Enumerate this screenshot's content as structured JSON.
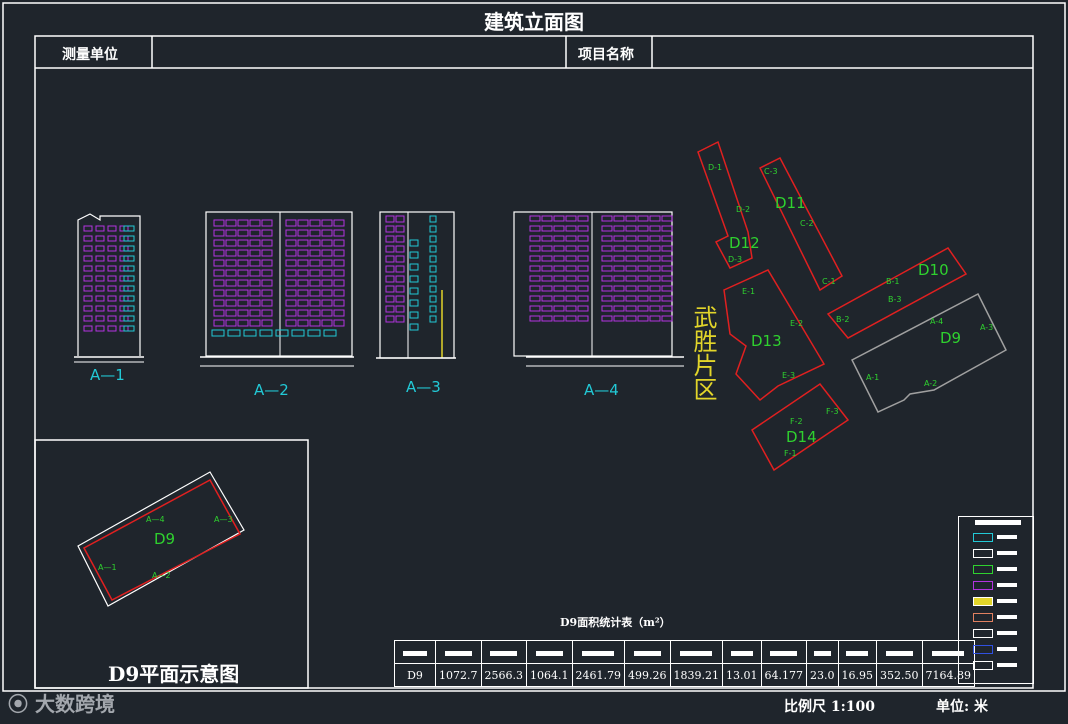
{
  "title": "建筑立面图",
  "header": {
    "survey_unit_label": "测量单位",
    "project_name_label": "项目名称"
  },
  "elevations": [
    {
      "id": "A-1",
      "label": "A—1"
    },
    {
      "id": "A-2",
      "label": "A—2"
    },
    {
      "id": "A-3",
      "label": "A—3"
    },
    {
      "id": "A-4",
      "label": "A—4"
    }
  ],
  "district_label": "武胜片区",
  "site_map": {
    "buildings": [
      "D9",
      "D10",
      "D11",
      "D12",
      "D13",
      "D14"
    ],
    "point_labels": [
      "D-1",
      "D-2",
      "D-3",
      "C-1",
      "C-2",
      "C-3",
      "B-1",
      "B-2",
      "B-3",
      "E-1",
      "E-2",
      "E-3",
      "F-1",
      "F-2",
      "F-3",
      "A-1",
      "A-2",
      "A-3",
      "A-4"
    ]
  },
  "plan": {
    "title": "D9平面示意图",
    "building": "D9",
    "corners": [
      "A—1",
      "A—2",
      "A—3",
      "A—4"
    ]
  },
  "stats_table": {
    "title": "D9面积统计表（m²）",
    "row_label": "D9",
    "values": [
      "1072.7",
      "2566.3",
      "1064.1",
      "2461.79",
      "499.26",
      "1839.21",
      "13.01",
      "64.177",
      "23.0",
      "16.95",
      "352.50",
      "7164.89"
    ]
  },
  "footer": {
    "scale": "比例尺 1:100",
    "unit": "单位: 米"
  },
  "watermark": "大数跨境",
  "colors": {
    "background": "#1f252c",
    "frame": "#ffffff",
    "cyan": "#22c9d6",
    "magenta": "#b333e0",
    "green": "#2fd12f",
    "yellow": "#e2d52a",
    "red": "#e02020",
    "gray": "#a0a0a0"
  }
}
